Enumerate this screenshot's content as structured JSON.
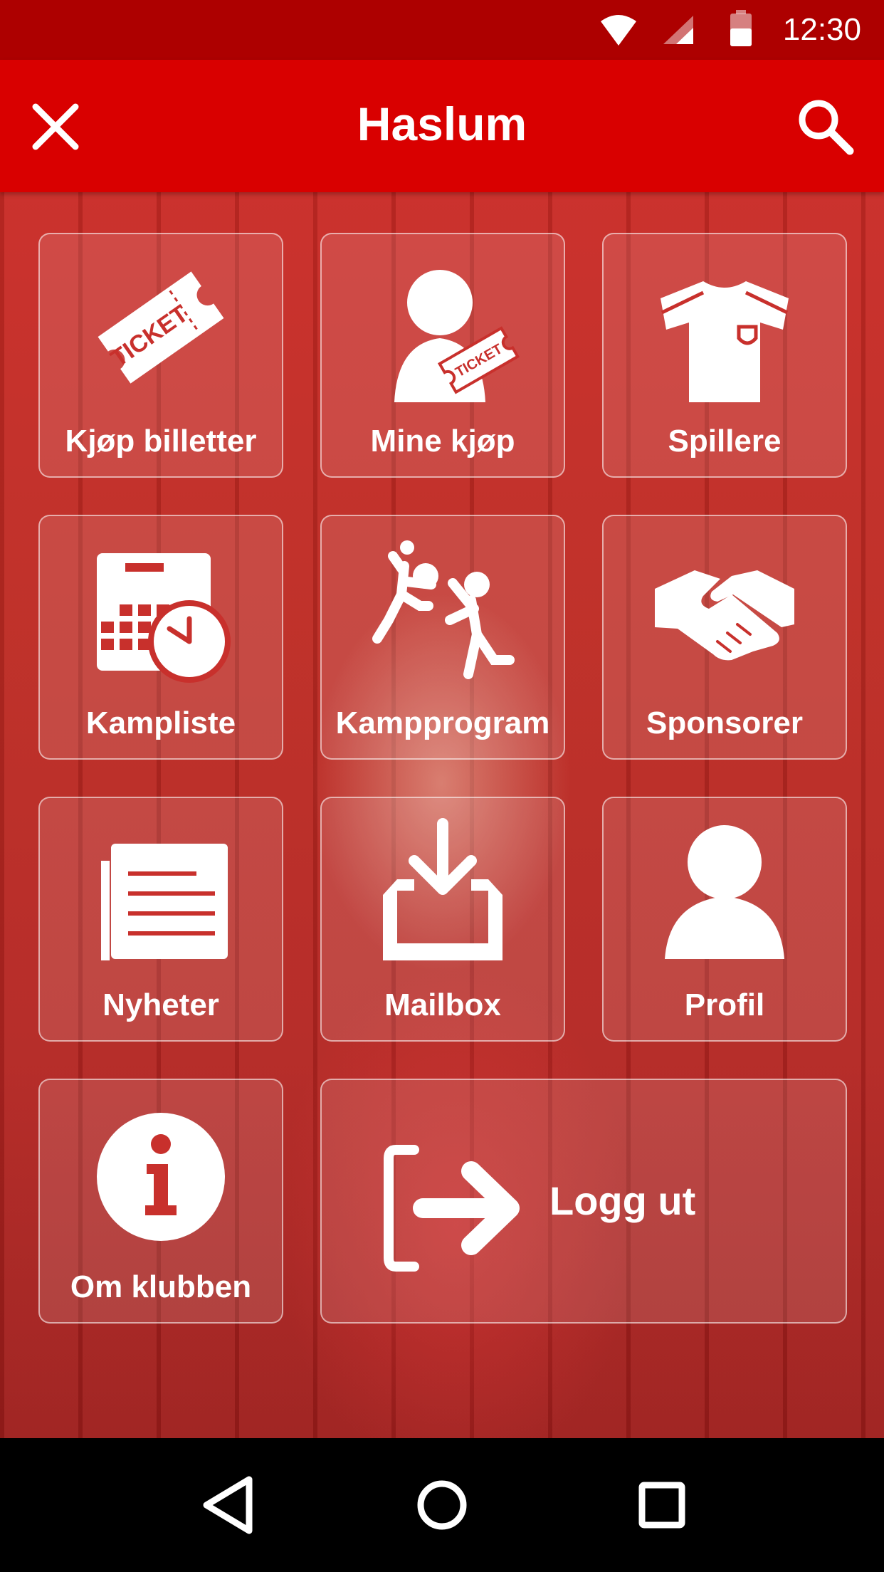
{
  "status_bar": {
    "time": "12:30",
    "icons": [
      "wifi-icon",
      "cell-signal-icon",
      "battery-icon"
    ]
  },
  "app_bar": {
    "title": "Haslum",
    "left_icon": "close-icon",
    "right_icon": "search-icon"
  },
  "tiles": [
    {
      "label": "Kjøp billetter",
      "icon": "ticket-icon"
    },
    {
      "label": "Mine kjøp",
      "icon": "user-ticket-icon"
    },
    {
      "label": "Spillere",
      "icon": "jersey-icon"
    },
    {
      "label": "Kampliste",
      "icon": "calendar-clock-icon"
    },
    {
      "label": "Kampprogram",
      "icon": "handball-players-icon"
    },
    {
      "label": "Sponsorer",
      "icon": "handshake-icon"
    },
    {
      "label": "Nyheter",
      "icon": "newspaper-icon"
    },
    {
      "label": "Mailbox",
      "icon": "inbox-download-icon"
    },
    {
      "label": "Profil",
      "icon": "person-icon"
    },
    {
      "label": "Om klubben",
      "icon": "info-icon"
    },
    {
      "label": "Logg ut",
      "icon": "logout-icon"
    }
  ],
  "ticket_text": "TICKET",
  "nav_bar": {
    "icons": [
      "back-triangle-icon",
      "home-circle-icon",
      "recents-square-icon"
    ]
  },
  "colors": {
    "status_bar": "#ad0000",
    "app_bar": "#d90000",
    "icon_fill": "#ffffff"
  }
}
